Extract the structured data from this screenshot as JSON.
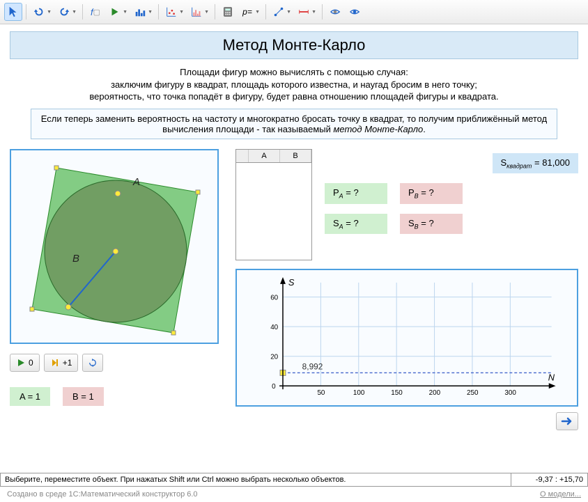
{
  "title": "Метод Монте-Карло",
  "intro": {
    "line1": "Площади фигур можно вычислять с помощью случая:",
    "line2": "заключим фигуру в квадрат, площадь которого известна, и наугад бросим в него точку;",
    "line3": "вероятность, что точка попадёт в фигуру, будет равна отношению площадей фигуры и квадрата."
  },
  "note": {
    "part1": "Если теперь заменить вероятность на частоту и многократно бросать точку в квадрат, то получим приближённый метод вычисления площади - так называемый ",
    "em": "метод Монте-Карло",
    "part2": "."
  },
  "geom": {
    "labelA": "A",
    "labelB": "B"
  },
  "controls": {
    "play_value": "0",
    "step_value": "+1"
  },
  "badges": {
    "a": "A = 1",
    "b": "B = 1"
  },
  "table": {
    "colA": "A",
    "colB": "B"
  },
  "stats": {
    "s_square": "Sквадрат = 81,000",
    "pa": "PA = ?",
    "pb": "PB = ?",
    "sa": "SA = ?",
    "sb": "SB = ?"
  },
  "chart_data": {
    "type": "line",
    "title": "",
    "xlabel": "N",
    "ylabel": "S",
    "xlim": [
      0,
      330
    ],
    "ylim": [
      0,
      65
    ],
    "x_ticks": [
      0,
      50,
      100,
      150,
      200,
      250,
      300
    ],
    "y_ticks": [
      0,
      20,
      40,
      60
    ],
    "annotation": {
      "x": 0,
      "y": 8.992,
      "label": "8,992"
    },
    "series": []
  },
  "status": {
    "msg": "Выберите, переместите объект. При нажатых Shift или Ctrl можно выбрать несколько объектов.",
    "coords": "-9,37 :  +15,70"
  },
  "footer": {
    "left": "Создано в среде 1С:Математический конструктор 6.0",
    "right": "О модели..."
  }
}
